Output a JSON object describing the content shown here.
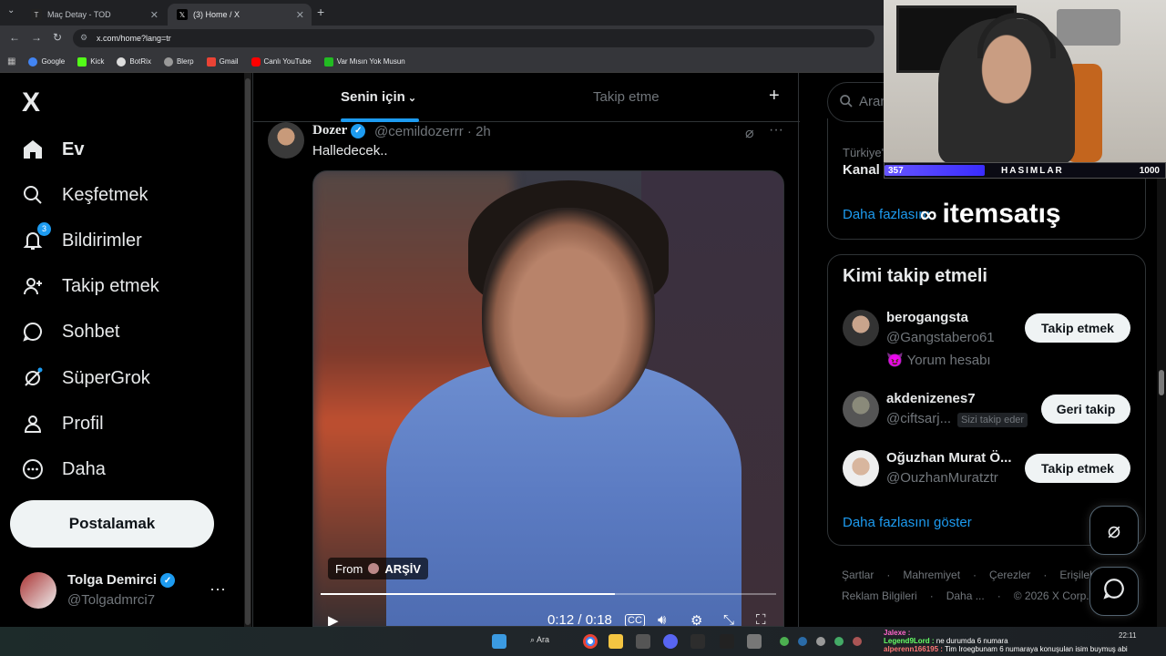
{
  "browser": {
    "tabs": [
      {
        "label": "Maç Detay - TOD",
        "favicon": "TOD"
      },
      {
        "label": "(3) Home / X",
        "favicon": "X"
      }
    ],
    "url": "x.com/home?lang=tr",
    "bookmarks": [
      "Google",
      "Kick",
      "BotRix",
      "Blerp",
      "Gmail",
      "Canlı YouTube",
      "Var Mısın Yok Musun"
    ]
  },
  "leftnav": {
    "logo": "X",
    "items": [
      {
        "label": "Ev",
        "icon": "home-icon"
      },
      {
        "label": "Keşfetmek",
        "icon": "search-icon"
      },
      {
        "label": "Bildirimler",
        "icon": "bell-icon",
        "badge": "3"
      },
      {
        "label": "Takip etmek",
        "icon": "follow-icon"
      },
      {
        "label": "Sohbet",
        "icon": "chat-icon"
      },
      {
        "label": "SüperGrok",
        "icon": "grok-icon"
      },
      {
        "label": "Profil",
        "icon": "person-icon"
      },
      {
        "label": "Daha",
        "icon": "more-circle-icon"
      }
    ],
    "post_label": "Postalamak",
    "profile": {
      "name": "Tolga Demirci",
      "handle": "@Tolgadmrci7"
    }
  },
  "feed": {
    "tabs": [
      "Senin için",
      "Takip etme"
    ],
    "add_label": "+",
    "tweet": {
      "name": "Dozer",
      "handle": "@cemildozerrr · 2h",
      "text": "Halledecek..",
      "video": {
        "from_label": "From",
        "from_source": "ARŞİV",
        "time": "0:12 / 0:18",
        "progress": 0.6467
      }
    }
  },
  "right": {
    "search_placeholder": "Aram",
    "trend": {
      "sub": "Türkiye'",
      "title": "Kanal",
      "more": "Daha fazlasını"
    },
    "follow": {
      "title": "Kimi takip etmeli",
      "users": [
        {
          "name": "berogangsta",
          "handle": "@Gangstabero61",
          "extra": "😈 Yorum hesabı",
          "button": "Takip etmek"
        },
        {
          "name": "akdenizenes7",
          "handle": "@ciftsarj...",
          "chip": "Sizi takip eder",
          "button": "Geri takip"
        },
        {
          "name": "Oğuzhan Murat Ö...",
          "handle": "@OuzhanMuratztr",
          "button": "Takip etmek"
        }
      ],
      "show_more": "Daha fazlasını göster"
    },
    "footer": [
      "Şartlar",
      "·",
      "Mahremiyet",
      "·",
      "Çerezler",
      "·",
      "Erişilebilirlik",
      "Reklam Bilgileri",
      "·",
      "Daha ...",
      "·",
      "© 2026 X Corp."
    ]
  },
  "overlay": {
    "hp_level": "357",
    "hp_name": "HASIMLAR",
    "hp_max": "1000",
    "hp_fraction": 0.357,
    "sponsor": "itemsatış"
  },
  "taskbar": {
    "search": "Ara",
    "clock": "22:11",
    "chat": [
      {
        "user": "Jalexe :",
        "msg": ""
      },
      {
        "user": "Legend9Lord :",
        "msg": "ne durumda 6 numara"
      },
      {
        "user": "alperenn166195 :",
        "msg": "Tim Iroegbunam 6 numaraya konuşulan isim buymuş abi"
      }
    ]
  },
  "colors": {
    "accent": "#1d9bf0",
    "bg": "#000000",
    "border": "#2f3336"
  }
}
